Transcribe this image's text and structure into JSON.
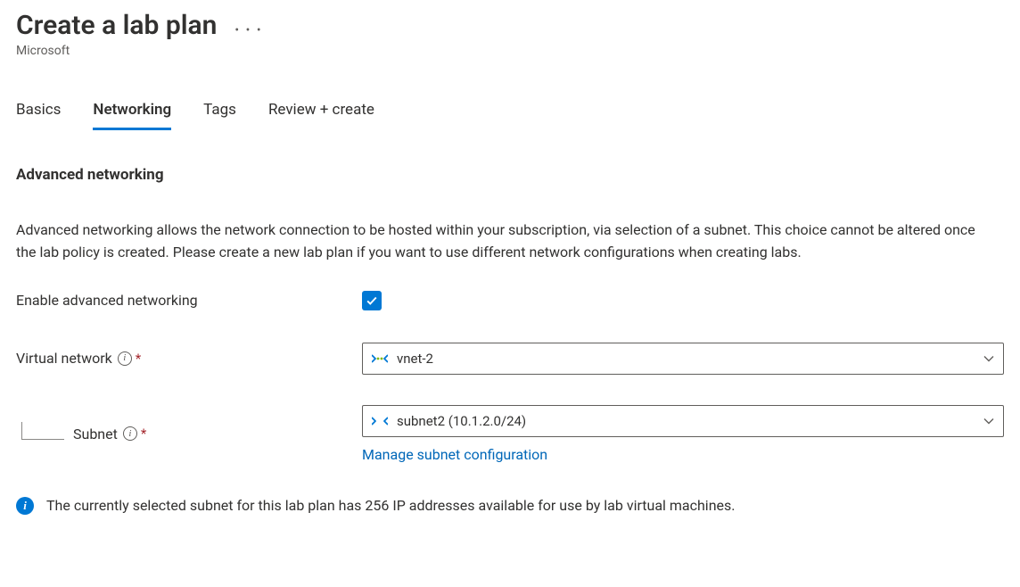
{
  "header": {
    "title": "Create a lab plan",
    "subtitle": "Microsoft"
  },
  "tabs": {
    "items": [
      {
        "label": "Basics",
        "active": false
      },
      {
        "label": "Networking",
        "active": true
      },
      {
        "label": "Tags",
        "active": false
      },
      {
        "label": "Review + create",
        "active": false
      }
    ]
  },
  "section": {
    "heading": "Advanced networking",
    "description": "Advanced networking allows the network connection to be hosted within your subscription, via selection of a subnet. This choice cannot be altered once the lab policy is created. Please create a new lab plan if you want to use different network configurations when creating labs."
  },
  "form": {
    "enable_label": "Enable advanced networking",
    "enable_checked": true,
    "vnet": {
      "label": "Virtual network",
      "required": true,
      "value": "vnet-2"
    },
    "subnet": {
      "label": "Subnet",
      "required": true,
      "value": "subnet2 (10.1.2.0/24)",
      "manage_link": "Manage subnet configuration"
    }
  },
  "info": {
    "message": "The currently selected subnet for this lab plan has 256 IP addresses available for use by lab virtual machines."
  }
}
